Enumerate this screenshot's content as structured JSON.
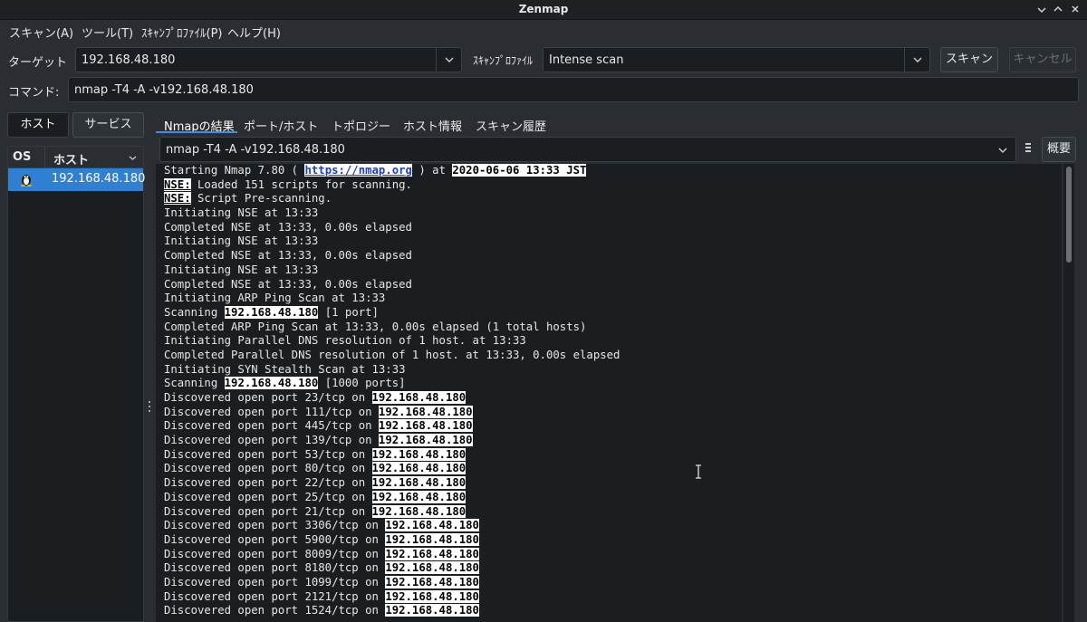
{
  "window": {
    "title": "Zenmap"
  },
  "menu": [
    "スキャン(A)",
    "ツール(T)",
    "ｽｷｬﾝﾌﾟﾛﾌｧｲﾙ(P)",
    "ヘルプ(H)"
  ],
  "target": {
    "label": "ターゲット",
    "value": "192.168.48.180"
  },
  "profile": {
    "label": "ｽｷｬﾝﾌﾟﾛﾌｧｲﾙ",
    "value": "Intense scan"
  },
  "buttons": {
    "scan": "スキャン",
    "cancel": "キャンセル",
    "details": "概要"
  },
  "command": {
    "label": "コマンド:",
    "value": "nmap -T4 -A -v192.168.48.180"
  },
  "left": {
    "hosts_btn": "ホスト",
    "services_btn": "サービス",
    "col_os": "OS",
    "col_host": "ホスト",
    "hosts": [
      "192.168.48.180"
    ]
  },
  "tabs": [
    "Nmapの結果",
    "ポート/ホスト",
    "トポロジー",
    "ホスト情報",
    "スキャン履歴"
  ],
  "output": {
    "command_select": "nmap -T4 -A -v192.168.48.180",
    "line0": {
      "a": "Starting Nmap 7.80 ( ",
      "link": "https://nmap.org",
      "b": " ) at ",
      "date": "2020-06-06 13:33 JST"
    },
    "nse": "NSE:",
    "nse1": " Loaded 151 scripts for scanning.",
    "nse2": " Script Pre-scanning.",
    "plain1": [
      "Initiating NSE at 13:33",
      "Completed NSE at 13:33, 0.00s elapsed",
      "Initiating NSE at 13:33",
      "Completed NSE at 13:33, 0.00s elapsed",
      "Initiating NSE at 13:33",
      "Completed NSE at 13:33, 0.00s elapsed",
      "Initiating ARP Ping Scan at 13:33"
    ],
    "scanning": "Scanning ",
    "ip": "192.168.48.180",
    "scan1_tail": " [1 port]",
    "plain2": [
      "Completed ARP Ping Scan at 13:33, 0.00s elapsed (1 total hosts)",
      "Initiating Parallel DNS resolution of 1 host. at 13:33",
      "Completed Parallel DNS resolution of 1 host. at 13:33, 0.00s elapsed",
      "Initiating SYN Stealth Scan at 13:33"
    ],
    "scan2_tail": " [1000 ports]",
    "ports": [
      "Discovered open port 23/tcp on ",
      "Discovered open port 111/tcp on ",
      "Discovered open port 445/tcp on ",
      "Discovered open port 139/tcp on ",
      "Discovered open port 53/tcp on ",
      "Discovered open port 80/tcp on ",
      "Discovered open port 22/tcp on ",
      "Discovered open port 25/tcp on ",
      "Discovered open port 21/tcp on ",
      "Discovered open port 3306/tcp on ",
      "Discovered open port 5900/tcp on ",
      "Discovered open port 8009/tcp on ",
      "Discovered open port 8180/tcp on ",
      "Discovered open port 1099/tcp on ",
      "Discovered open port 2121/tcp on ",
      "Discovered open port 1524/tcp on "
    ]
  }
}
